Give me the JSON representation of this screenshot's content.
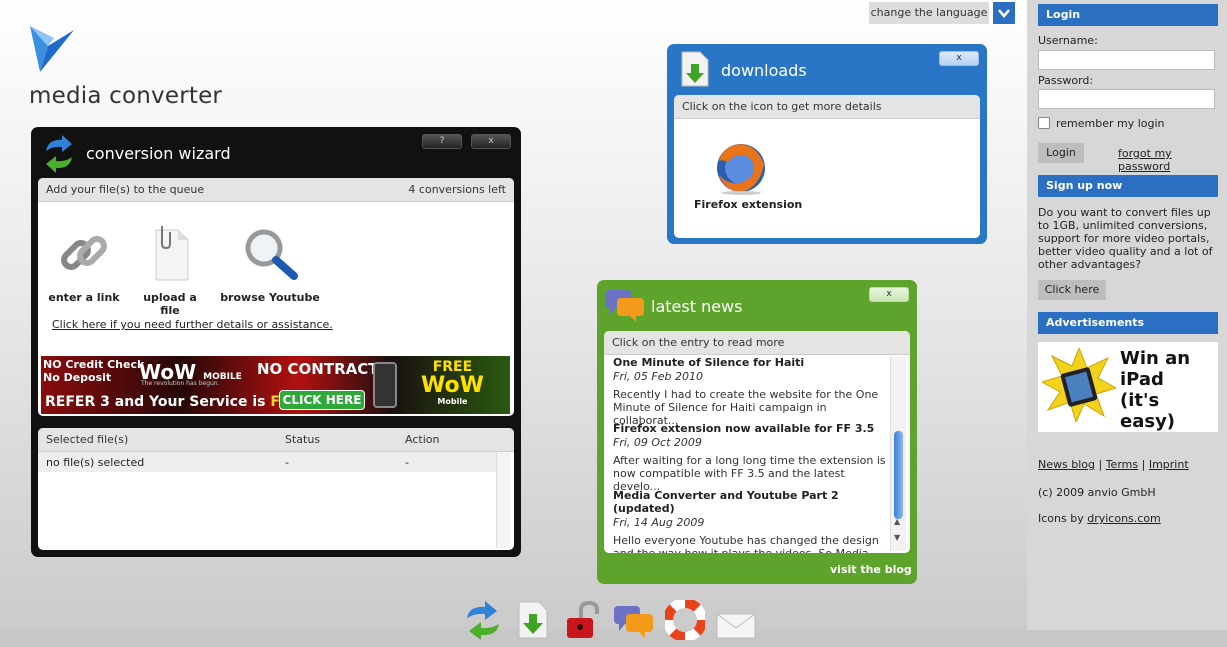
{
  "logo": {
    "title": "media converter",
    "icon": "bird-logo-icon"
  },
  "language": {
    "label": "change the language",
    "icon": "chevron-down-icon"
  },
  "wizard": {
    "title": "conversion wizard",
    "help_label": "?",
    "close_label": "x",
    "queue_label": "Add your file(s) to the queue",
    "conversions_left": "4 conversions left",
    "tools": [
      {
        "label": "enter a link",
        "icon": "chain-link-icon"
      },
      {
        "label": "upload a file",
        "icon": "document-icon"
      },
      {
        "label": "browse Youtube",
        "icon": "magnifier-icon"
      }
    ],
    "help_link": "Click here if you need further details or assistance.",
    "ad": {
      "line1": "NO Credit Check",
      "line2": "No Deposit",
      "brand": "WoW",
      "brand_sub": "MOBILE",
      "tagline": "The revolution has begun.",
      "contract": "NO CONTRACT!",
      "refer": "REFER 3 and Your Service is",
      "free": "FREE",
      "cta": "CLICK HERE",
      "free2": "FREE",
      "wow2": "WoW",
      "mobile2": "Mobile"
    },
    "table": {
      "headers": [
        "Selected file(s)",
        "Status",
        "Action"
      ],
      "row": [
        "no file(s) selected",
        "-",
        "-"
      ]
    }
  },
  "downloads": {
    "title": "downloads",
    "close_label": "x",
    "hint": "Click on the icon to get more details",
    "items": [
      {
        "label": "Firefox extension",
        "icon": "firefox-icon"
      }
    ]
  },
  "news": {
    "title": "latest news",
    "close_label": "x",
    "hint": "Click on the entry to read more",
    "items": [
      {
        "title": "One Minute of Silence for Haiti",
        "date": "Fri, 05 Feb 2010",
        "text": "Recently I had to create the website for the One Minute of Silence for Haiti campaign in collaborat..."
      },
      {
        "title": "Firefox extension now available for FF 3.5",
        "date": "Fri, 09 Oct 2009",
        "text": "After waiting for a long long time the extension is now compatible with FF 3.5 and the latest develo..."
      },
      {
        "title": "Media Converter and Youtube Part 2 (updated)",
        "date": "Fri, 14 Aug 2009",
        "text": "Hello everyone Youtube has changed the design and the way how it plays the videos. So Media Converte..."
      }
    ],
    "visit_label": "visit the blog"
  },
  "sidebar": {
    "login_header": "Login",
    "username_label": "Username:",
    "password_label": "Password:",
    "remember_label": "remember my login",
    "login_button": "Login",
    "forgot_link": "forgot my password",
    "signup_header": "Sign up now",
    "signup_text": "Do you want to convert files up to 1GB, unlimited conversions, support for more video portals, better video quality and a lot of other advantages?",
    "signup_button": "Click here",
    "ads_header": "Advertisements",
    "ad_line1": "Win an",
    "ad_line2": "iPad",
    "ad_line3": "(it's easy)",
    "footer_links": [
      "News blog",
      "Terms",
      "Imprint"
    ],
    "footer_sep": "|",
    "copyright": "(c) 2009 anvio GmbH",
    "icons_by_prefix": "Icons by",
    "icons_by_link": "dryicons.com"
  },
  "dock": [
    "convert-icon",
    "download-icon",
    "lock-icon",
    "chat-icon",
    "lifebuoy-icon",
    "mail-icon"
  ]
}
